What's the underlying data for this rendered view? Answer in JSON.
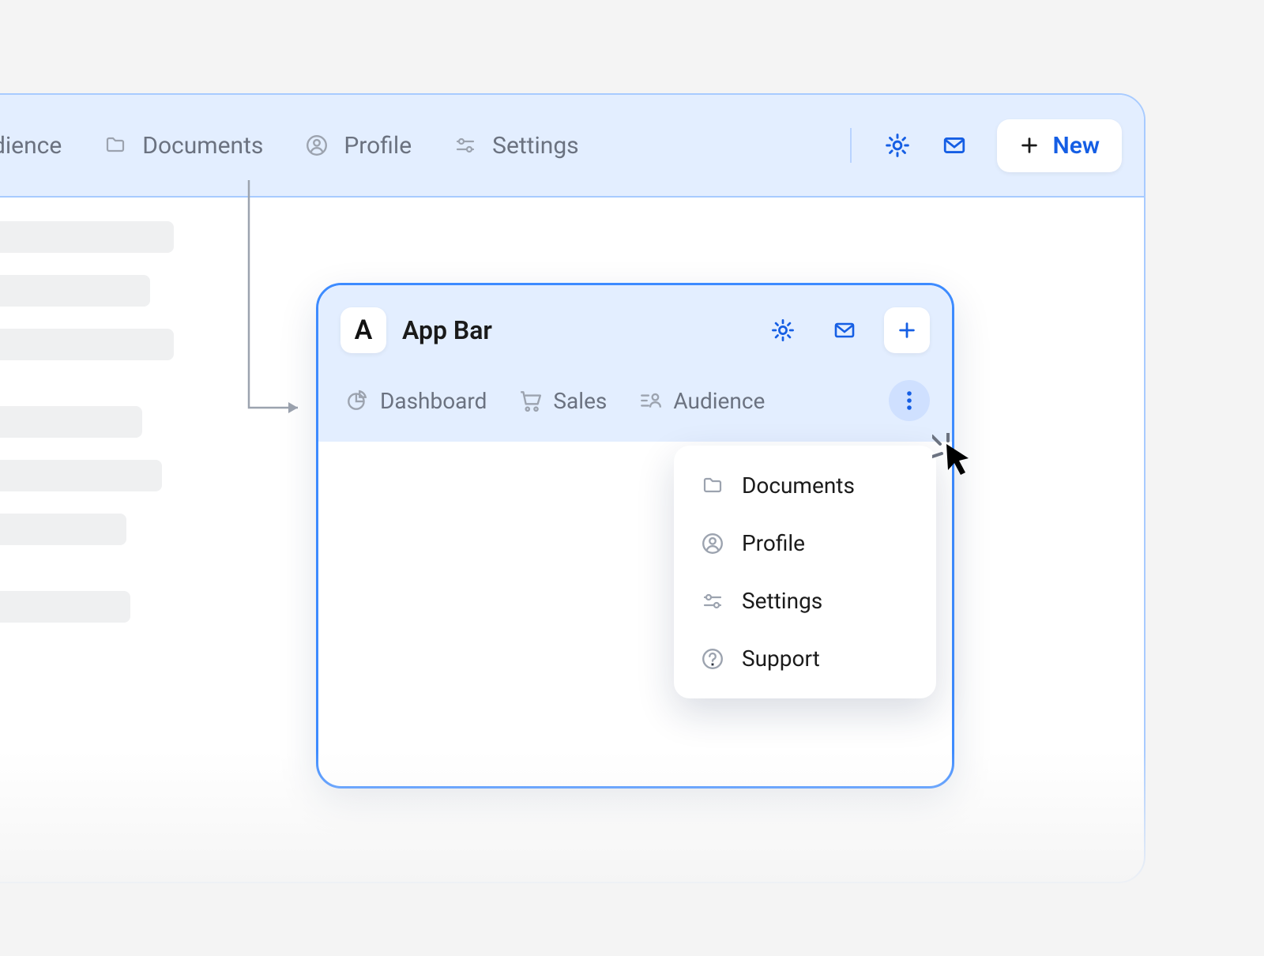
{
  "outer": {
    "nav": {
      "audience": "Audience",
      "documents": "Documents",
      "profile": "Profile",
      "settings": "Settings"
    },
    "new_button": "New"
  },
  "inner": {
    "tile_letter": "A",
    "title": "App Bar",
    "tabs": {
      "dashboard": "Dashboard",
      "sales": "Sales",
      "audience": "Audience"
    }
  },
  "dropdown": {
    "documents": "Documents",
    "profile": "Profile",
    "settings": "Settings",
    "support": "Support"
  },
  "icons": {
    "folder": "folder-icon",
    "profile": "profile-icon",
    "settings_sliders": "sliders-icon",
    "gear": "gear-icon",
    "mail": "mail-icon",
    "plus": "plus-icon",
    "chart": "chart-icon",
    "cart": "cart-icon",
    "people": "people-icon",
    "more": "more-vertical-icon",
    "help": "help-icon"
  },
  "colors": {
    "accent": "#155ee4",
    "panel_bg": "#e3eeff",
    "panel_border": "#3d8bff",
    "muted": "#6b7280"
  }
}
